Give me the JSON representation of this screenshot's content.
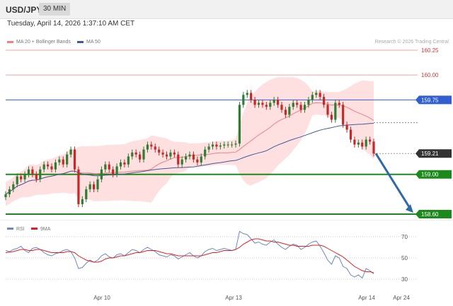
{
  "header": {
    "symbol": "USD/JPY",
    "timeframe": "30 MIN"
  },
  "datetime": "Tuesday, April 14, 2026 1:37:10 AM CET",
  "legend": {
    "items": [
      {
        "label": "MA 20 + Bollinger Bands",
        "color": "#f08080"
      },
      {
        "label": "MA 50",
        "color": "#3f5a9a"
      }
    ],
    "source": "Research © 2026 Trading Central"
  },
  "price_levels": [
    {
      "label": "160.25",
      "value": 160.25,
      "style": "red-line"
    },
    {
      "label": "160.00",
      "value": 160.0,
      "style": "red-line"
    },
    {
      "label": "159.75",
      "value": 159.75,
      "style": "blue-tag"
    },
    {
      "label": "159.21",
      "value": 159.21,
      "style": "current-tag"
    },
    {
      "label": "159.00",
      "value": 159.0,
      "style": "green-tag"
    },
    {
      "label": "158.60",
      "value": 158.6,
      "style": "green-tag"
    }
  ],
  "rsi_legend": [
    {
      "label": "RSI",
      "color": "#6a88c8"
    },
    {
      "label": "9MA",
      "color": "#e02020"
    }
  ],
  "rsi_levels": [
    "70",
    "50",
    "30"
  ],
  "x_labels": [
    "Apr 10",
    "Apr 13",
    "Apr 14",
    "Apr 24"
  ],
  "colors": {
    "up": "#2e7d32",
    "down": "#c62828",
    "support": "#1b8a1b",
    "resistance": "#f4a3a3",
    "blue": "#2f5fd0",
    "arrow": "#2f6aa8"
  },
  "chart_data": [
    {
      "type": "candlestick",
      "y_axis": "price",
      "ylim": [
        158.55,
        160.3
      ],
      "close_series": [
        158.8,
        158.85,
        158.9,
        158.98,
        158.95,
        159.0,
        159.05,
        159.0,
        158.95,
        159.05,
        159.1,
        159.08,
        159.05,
        159.12,
        159.15,
        159.1,
        159.2,
        159.25,
        159.05,
        158.7,
        158.75,
        158.85,
        158.9,
        158.85,
        158.95,
        159.05,
        159.1,
        159.05,
        159.0,
        159.08,
        159.12,
        159.1,
        159.18,
        159.22,
        159.2,
        159.15,
        159.25,
        159.3,
        159.28,
        159.25,
        159.22,
        159.2,
        159.18,
        159.22,
        159.2,
        159.1,
        159.15,
        159.18,
        159.2,
        159.15,
        159.12,
        159.18,
        159.25,
        159.28,
        159.3,
        159.28,
        159.29,
        159.3,
        159.3,
        159.3,
        159.31,
        159.7,
        159.8,
        159.82,
        159.75,
        159.7,
        159.72,
        159.7,
        159.68,
        159.72,
        159.75,
        159.7,
        159.65,
        159.6,
        159.68,
        159.72,
        159.7,
        159.65,
        159.7,
        159.75,
        159.8,
        159.82,
        159.78,
        159.7,
        159.6,
        159.55,
        159.72,
        159.7,
        159.5,
        159.45,
        159.35,
        159.3,
        159.32,
        159.28,
        159.35,
        159.33,
        159.21
      ],
      "current_price": 159.21,
      "projection": {
        "from": 159.21,
        "to": 158.6,
        "direction": "down"
      }
    },
    {
      "type": "line",
      "title": "RSI",
      "series_names": [
        "RSI",
        "9MA"
      ],
      "ylim": [
        20,
        80
      ],
      "levels": [
        70,
        50,
        30
      ],
      "rsi": [
        57,
        56,
        58,
        59,
        61,
        57,
        55,
        59,
        60,
        58,
        55,
        53,
        52,
        54,
        55,
        57,
        58,
        56,
        50,
        40,
        41,
        45,
        48,
        46,
        48,
        52,
        54,
        51,
        50,
        53,
        54,
        52,
        55,
        58,
        57,
        55,
        58,
        60,
        58,
        56,
        53,
        52,
        51,
        53,
        52,
        49,
        51,
        53,
        55,
        52,
        50,
        52,
        56,
        58,
        59,
        57,
        58,
        59,
        58,
        57,
        58,
        75,
        73,
        72,
        68,
        64,
        65,
        63,
        62,
        65,
        67,
        63,
        60,
        58,
        61,
        63,
        62,
        58,
        60,
        63,
        65,
        66,
        61,
        55,
        48,
        44,
        52,
        50,
        42,
        40,
        34,
        32,
        34,
        31,
        40,
        38,
        35
      ],
      "ma9": [
        55,
        55.5,
        56,
        57,
        58,
        58,
        57,
        57,
        58,
        58,
        57,
        56,
        55,
        55,
        55,
        55,
        56,
        56,
        55,
        52,
        50,
        48,
        47,
        46,
        46,
        47,
        49,
        50,
        50,
        51,
        52,
        52,
        53,
        54,
        55,
        55,
        56,
        57,
        57,
        57,
        56,
        55,
        54,
        54,
        53,
        52,
        52,
        52,
        52,
        52,
        52,
        52,
        53,
        54,
        55,
        55,
        56,
        57,
        57,
        57,
        58,
        60,
        63,
        65,
        67,
        68,
        68,
        67,
        66,
        66,
        65,
        65,
        64,
        63,
        62,
        62,
        61,
        61,
        61,
        61,
        62,
        62,
        62,
        61,
        59,
        57,
        55,
        53,
        51,
        48,
        45,
        42,
        40,
        38,
        37,
        37,
        36
      ]
    }
  ]
}
